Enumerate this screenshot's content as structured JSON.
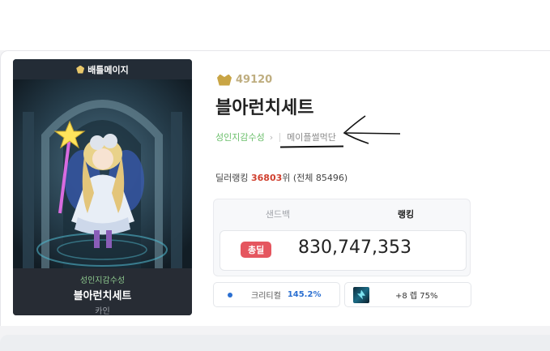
{
  "character_panel": {
    "header_label": "배틀메이지",
    "guild": "성인지감수성",
    "name": "블아런치세트",
    "class": "카인"
  },
  "profile": {
    "level": "49120",
    "name": "블아런치세트",
    "world_link": "성인지감수성",
    "guild_link": "메이플썰먹단",
    "damage_rank_prefix": "딜러랭킹 ",
    "damage_rank": "36803",
    "damage_rank_suffix": "위 (전체 85496)"
  },
  "stats": {
    "tabs": [
      "샌드백",
      "랭킹"
    ],
    "active_tab": "랭킹",
    "total_label": "총딜",
    "total_value": "830,747,353"
  },
  "mini_stats": {
    "crit_label": "크리티컬",
    "crit_value": "145.2%",
    "arcane_label": "+8 렙 75%"
  },
  "colors": {
    "accent_red": "#e5565f",
    "rank_red": "#d0402f",
    "world_green": "#6bbf6b",
    "crit_blue": "#2b6fd1"
  }
}
